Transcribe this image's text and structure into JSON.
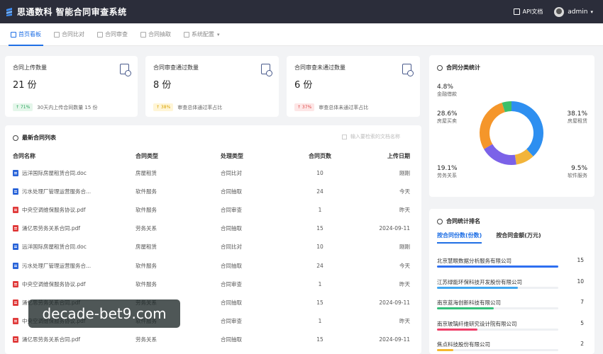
{
  "app": {
    "brand": "思通数科 智能合同审查系统"
  },
  "header": {
    "api_doc": "API文档",
    "user": "admin"
  },
  "tabs": [
    {
      "label": "首页看板",
      "icon": "home-icon",
      "active": true
    },
    {
      "label": "合同比对",
      "icon": "compare-icon",
      "active": false
    },
    {
      "label": "合同审查",
      "icon": "review-icon",
      "active": false
    },
    {
      "label": "合同抽取",
      "icon": "extract-icon",
      "active": false
    },
    {
      "label": "系统配置",
      "icon": "settings-icon",
      "active": false
    }
  ],
  "stats": [
    {
      "title": "合同上传数量",
      "value": "21 份",
      "badge": "↑ 71%",
      "badge_color": "green",
      "note": "30天内上传合同数量 15 份",
      "icon": "upload-doc-icon"
    },
    {
      "title": "合同审查通过数量",
      "value": "8 份",
      "badge": "↑ 38%",
      "badge_color": "yellow",
      "note": "审查总体通过率占比",
      "icon": "approved-doc-icon"
    },
    {
      "title": "合同审查未通过数量",
      "value": "6 份",
      "badge": "↑ 37%",
      "badge_color": "red",
      "note": "审查总体未通过率占比",
      "icon": "rejected-doc-icon"
    }
  ],
  "contract_list": {
    "title": "最新合同列表",
    "search_placeholder": "输入要检索的文档名称",
    "columns": [
      "合同名称",
      "合同类型",
      "处理类型",
      "合同页数",
      "上传日期"
    ],
    "rows": [
      {
        "name": "远洋国际房屋租赁合同.doc",
        "file": "doc",
        "type": "房屋租赁",
        "process": "合同比对",
        "pages": "10",
        "date": "刚刚"
      },
      {
        "name": "污水处理厂管理运营服务合...",
        "file": "doc",
        "type": "软件服务",
        "process": "合同抽取",
        "pages": "24",
        "date": "今天"
      },
      {
        "name": "中央空调维保服务协议.pdf",
        "file": "pdf",
        "type": "软件服务",
        "process": "合同审查",
        "pages": "1",
        "date": "昨天"
      },
      {
        "name": "涌亿思劳务关系合同.pdf",
        "file": "pdf",
        "type": "劳务关系",
        "process": "合同抽取",
        "pages": "15",
        "date": "2024-09-11"
      },
      {
        "name": "远洋国际房屋租赁合同.doc",
        "file": "doc",
        "type": "房屋租赁",
        "process": "合同比对",
        "pages": "10",
        "date": "刚刚"
      },
      {
        "name": "污水处理厂管理运营服务合...",
        "file": "doc",
        "type": "软件服务",
        "process": "合同抽取",
        "pages": "24",
        "date": "今天"
      },
      {
        "name": "中央空调维保服务协议.pdf",
        "file": "pdf",
        "type": "软件服务",
        "process": "合同审查",
        "pages": "1",
        "date": "昨天"
      },
      {
        "name": "涌亿思劳务关系合同.pdf",
        "file": "pdf",
        "type": "劳务关系",
        "process": "合同抽取",
        "pages": "15",
        "date": "2024-09-11"
      },
      {
        "name": "中央空调维保服务协议.pdf",
        "file": "pdf",
        "type": "软件服务",
        "process": "合同审查",
        "pages": "1",
        "date": "昨天"
      },
      {
        "name": "涌亿思劳务关系合同.pdf",
        "file": "pdf",
        "type": "劳务关系",
        "process": "合同抽取",
        "pages": "15",
        "date": "2024-09-11"
      }
    ]
  },
  "category_stats": {
    "title": "合同分类统计",
    "segments": [
      {
        "label": "房屋租赁",
        "pct": "38.1%",
        "value": 38.1,
        "color": "#2e8ff0"
      },
      {
        "label": "软件服务",
        "pct": "9.5%",
        "value": 9.5,
        "color": "#f2b43a"
      },
      {
        "label": "劳务关系",
        "pct": "19.1%",
        "value": 19.1,
        "color": "#7b62e8"
      },
      {
        "label": "房屋买卖",
        "pct": "28.6%",
        "value": 28.6,
        "color": "#f5962a"
      },
      {
        "label": "金融借款",
        "pct": "4.8%",
        "value": 4.8,
        "color": "#3cbf6a"
      }
    ]
  },
  "ranking": {
    "title": "合同统计排名",
    "tabs": [
      "按合同份数(份数)",
      "按合同金额(万元)"
    ],
    "items": [
      {
        "name": "北京慧眼数据分析服务有限公司",
        "count": "15",
        "value": 15,
        "color": "#2e6ff0"
      },
      {
        "name": "江苏绿能环保科技开发股份有限公司",
        "count": "10",
        "value": 10,
        "color": "#3fa6f0"
      },
      {
        "name": "南京蓝海创新科技有限公司",
        "count": "7",
        "value": 7,
        "color": "#34c07a"
      },
      {
        "name": "南京玻璃纤维研究设计院有限公司",
        "count": "5",
        "value": 5,
        "color": "#f0406a"
      },
      {
        "name": "焦点科技股份有限公司",
        "count": "2",
        "value": 2,
        "color": "#f5b82e"
      }
    ]
  },
  "watermark": "decade-bet9.com"
}
